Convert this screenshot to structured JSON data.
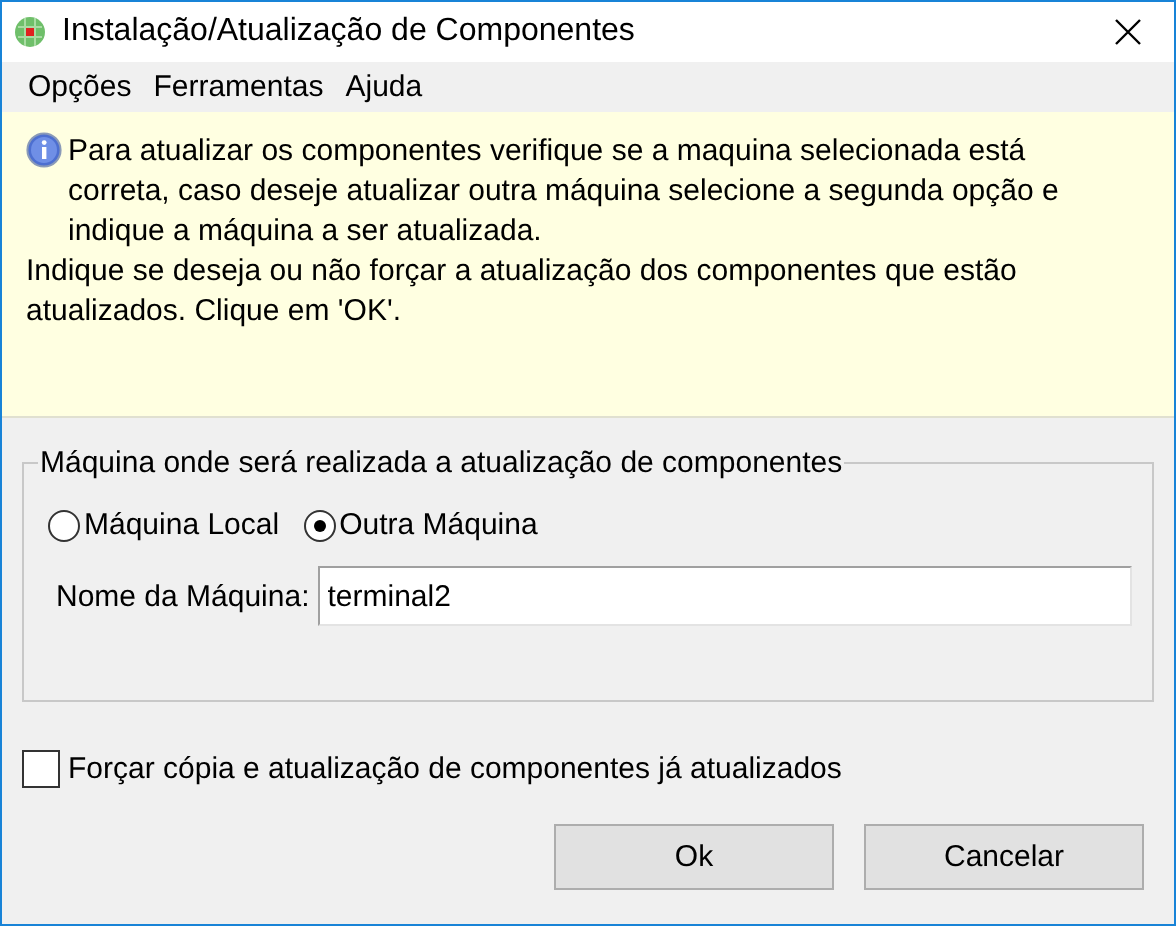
{
  "window": {
    "title": "Instalação/Atualização de Componentes"
  },
  "menu": [
    "Opções",
    "Ferramentas",
    "Ajuda"
  ],
  "info": {
    "paragraphs": [
      "Para atualizar os componentes verifique se a maquina selecionada está correta, caso deseje atualizar outra máquina selecione a segunda opção e indique a máquina a ser atualizada.",
      "Indique se deseja ou não forçar a atualização dos componentes que estão atualizados. Clique em 'OK'."
    ]
  },
  "group": {
    "title": "Máquina onde será realizada a atualização de componentes",
    "options": [
      {
        "label": "Máquina Local",
        "selected": false
      },
      {
        "label": "Outra Máquina",
        "selected": true
      }
    ],
    "name_field": {
      "label": "Nome da Máquina:",
      "value": "terminal2"
    }
  },
  "force_checkbox": {
    "label": "Forçar cópia e atualização de componentes já atualizados",
    "checked": false
  },
  "buttons": [
    "Ok",
    "Cancelar"
  ]
}
